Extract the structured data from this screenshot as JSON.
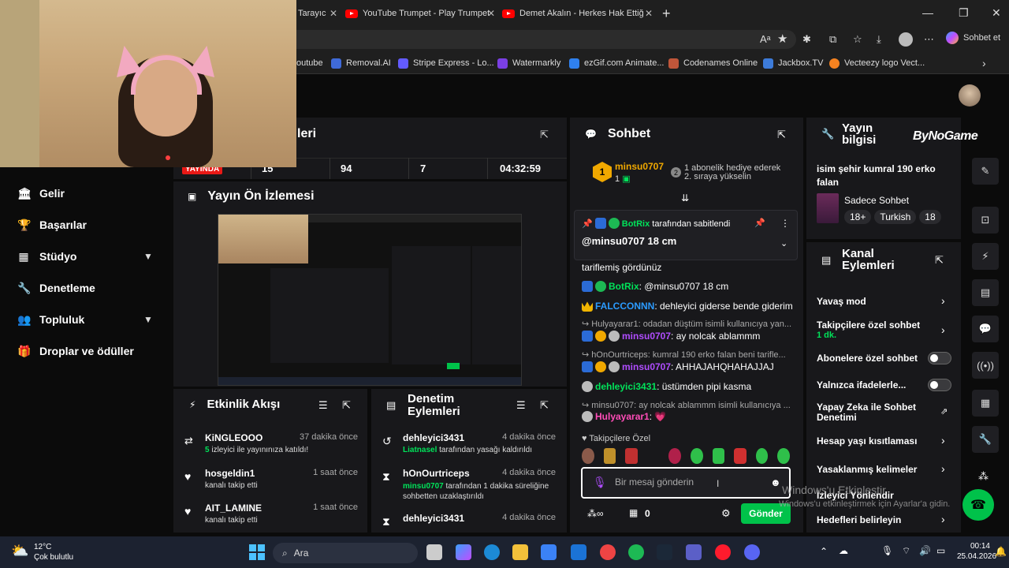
{
  "browser": {
    "tabs": [
      {
        "label": "Tarayıc"
      },
      {
        "label": "YouTube Trumpet - Play Trumpet v"
      },
      {
        "label": "Demet Akalın - Herkes Hak Ettiği C"
      }
    ],
    "new_tab": "+",
    "copilot_label": "Sohbet et",
    "bookmarks": [
      {
        "label": "outube",
        "color": "#ff0000"
      },
      {
        "label": "Removal.AI",
        "color": "#3f6ad8"
      },
      {
        "label": "Stripe Express - Lo...",
        "color": "#635bff"
      },
      {
        "label": "Watermarkly",
        "color": "#7b3fe4"
      },
      {
        "label": "ezGif.com Animate...",
        "color": "#2f80ed"
      },
      {
        "label": "Codenames Online",
        "color": "#c0563a"
      },
      {
        "label": "Jackbox.TV",
        "color": "#3d7bd9"
      },
      {
        "label": "Vecteezy logo Vect...",
        "color": "#f58220"
      }
    ]
  },
  "sidebar": {
    "items": [
      {
        "label": "Gelir",
        "icon": "bank-icon"
      },
      {
        "label": "Başarılar",
        "icon": "trophy-icon"
      },
      {
        "label": "Stüdyo",
        "icon": "film-icon"
      },
      {
        "label": "Denetleme",
        "icon": "wrench-icon"
      },
      {
        "label": "Topluluk",
        "icon": "users-icon"
      },
      {
        "label": "Droplar ve ödüller",
        "icon": "gift-icon"
      }
    ]
  },
  "stats": {
    "title_fragment": "leri",
    "live": "YAYINDA",
    "viewers": "15",
    "followers": "94",
    "subs": "7",
    "uptime": "04:32:59"
  },
  "preview": {
    "title": "Yayın Ön İzlemesi"
  },
  "activity": {
    "title": "Etkinlik Akışı",
    "items": [
      {
        "name": "KiNGLEOOO",
        "time": "37 dakika önce",
        "sub_count": "5",
        "sub_text": "izleyici ile yayınınıza katıldı!"
      },
      {
        "name": "hosgeldin1",
        "time": "1 saat önce",
        "sub_text": "kanalı takip etti"
      },
      {
        "name": "AIT_LAMINE",
        "time": "1 saat önce",
        "sub_text": "kanalı takip etti"
      }
    ]
  },
  "modactions": {
    "title": "Denetim Eylemleri",
    "items": [
      {
        "name": "dehleyici3431",
        "time": "4 dakika önce",
        "actor": "Liatnasel",
        "text": "tarafından yasağı kaldırıldı"
      },
      {
        "name": "hOnOurtriceps",
        "time": "4 dakika önce",
        "actor": "minsu0707",
        "text": "tarafından 1 dakika süreliğine sohbetten uzaklaştırıldı"
      },
      {
        "name": "dehleyici3431",
        "time": "4 dakika önce"
      }
    ]
  },
  "chat": {
    "title": "Sohbet",
    "hype_user": "minsu0707",
    "hype_count": "1",
    "hype_rank": "2",
    "hype_text1": "1 abonelik hediye ederek",
    "hype_text2": "2. sıraya yükselin",
    "pinned_by": "BotRix",
    "pinned_suffix": "tarafından sabitlendi",
    "pinned_msg": "@minsu0707 18 cm",
    "messages": [
      {
        "type": "text",
        "text": "tariflemiş gördünüz"
      },
      {
        "type": "msg",
        "user": "BotRix",
        "user_color": "#00e35a",
        "text": ": @minsu0707 18 cm"
      },
      {
        "type": "msg",
        "user": "FALCCONNN",
        "user_color": "#2b9bff",
        "text": ": dehleyici giderse bende giderim"
      },
      {
        "type": "reply",
        "text": "Hulyayarar1: odadan düştüm isimli kullanıcıya yan..."
      },
      {
        "type": "msg",
        "user": "minsu0707",
        "user_color": "#b04dff",
        "text": ": ay nolcak ablammm"
      },
      {
        "type": "reply",
        "text": "hOnOurtriceps: kumral 190 erko falan beni tarifle..."
      },
      {
        "type": "msg",
        "user": "minsu0707",
        "user_color": "#b04dff",
        "text": ": AHHAJAHQHAHAJJAJ"
      },
      {
        "type": "msg",
        "user": "dehleyici3431",
        "user_color": "#00e35a",
        "text": ": üstümden pipi kasma"
      },
      {
        "type": "reply",
        "text": "minsu0707: ay nolcak ablammm isimli kullanıcıya ..."
      },
      {
        "type": "msg",
        "user": "Hulyayarar1",
        "user_color": "#ff4db8",
        "text": ":"
      }
    ],
    "followers_only": "Takipçilere Özel",
    "input_placeholder": "Bir mesaj gönderin",
    "points": "0",
    "send": "Gönder"
  },
  "streaminfo": {
    "title": "Yayın bilgisi",
    "stream_title": "isim şehir kumral 190 erko falan",
    "category": "Sadece Sohbet",
    "tags": [
      "18+",
      "Turkish",
      "18"
    ],
    "brand": "ByNoGame"
  },
  "channel_actions": {
    "title": "Kanal Eylemleri",
    "items": [
      {
        "label": "Yavaş mod",
        "kind": "chevron"
      },
      {
        "label": "Takipçilere özel sohbet",
        "sub": "1 dk.",
        "kind": "chevron"
      },
      {
        "label": "Abonelere özel sohbet",
        "kind": "toggle"
      },
      {
        "label": "Yalnızca ifadelerle...",
        "kind": "toggle"
      },
      {
        "label": "Yapay Zeka ile Sohbet Denetimi",
        "kind": "external"
      },
      {
        "label": "Hesap yaşı kısıtlaması",
        "kind": "chevron"
      },
      {
        "label": "Yasaklanmış kelimeler",
        "kind": "chevron"
      },
      {
        "label": "İzleyici Yönlendir",
        "kind": "none"
      },
      {
        "label": "Hedefleri belirleyin",
        "kind": "chevron"
      }
    ]
  },
  "watermark": {
    "line1": "Windows'u Etkinleştir",
    "line2": "Windows'u etkinleştirmek için Ayarlar'a gidin."
  },
  "taskbar": {
    "weather_temp": "12°C",
    "weather_desc": "Çok bulutlu",
    "search": "Ara",
    "time": "00:14",
    "date": "25.04.2026"
  }
}
